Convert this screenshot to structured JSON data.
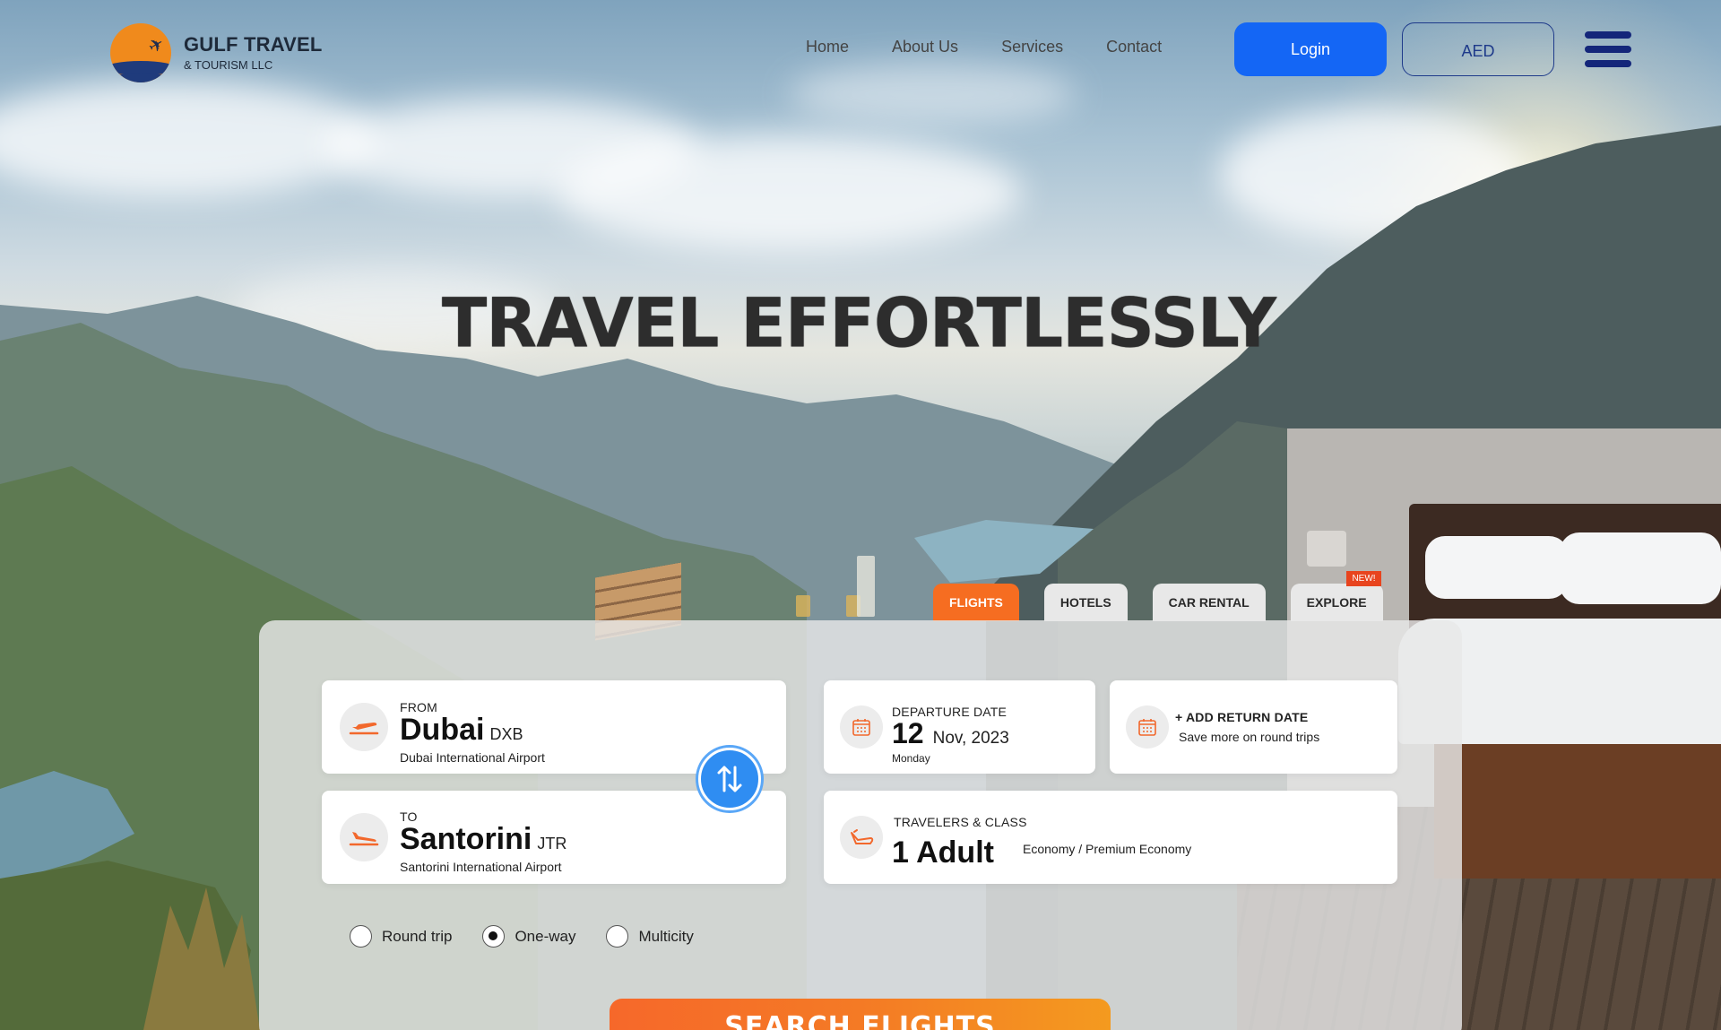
{
  "brand": {
    "title": "GULF TRAVEL",
    "subtitle": "& TOURISM LLC"
  },
  "nav": {
    "items": [
      "Home",
      "About Us",
      "Services",
      "Contact"
    ]
  },
  "header": {
    "login_label": "Login",
    "currency_label": "AED"
  },
  "hero": {
    "title": "TRAVEL EFFORTLESSLY"
  },
  "tabs": [
    {
      "label": "FLIGHTS",
      "active": true
    },
    {
      "label": "HOTELS",
      "active": false
    },
    {
      "label": "CAR RENTAL",
      "active": false
    },
    {
      "label": "EXPLORE",
      "active": false,
      "badge": "NEW!"
    }
  ],
  "search": {
    "from": {
      "label": "FROM",
      "city": "Dubai",
      "code": "DXB",
      "airport": "Dubai International Airport"
    },
    "to": {
      "label": "TO",
      "city": "Santorini",
      "code": "JTR",
      "airport": "Santorini International Airport"
    },
    "departure": {
      "label": "DEPARTURE DATE",
      "day": "12",
      "month_year": "Nov, 2023",
      "weekday": "Monday"
    },
    "return": {
      "label": "+ ADD RETURN DATE",
      "hint": "Save more on round trips"
    },
    "travelers": {
      "label": "TRAVELERS & CLASS",
      "count": "1",
      "type": "Adult",
      "class": "Economy / Premium Economy"
    },
    "trip_types": [
      {
        "label": "Round trip",
        "selected": false
      },
      {
        "label": "One-way",
        "selected": true
      },
      {
        "label": "Multicity",
        "selected": false
      }
    ],
    "submit_label": "SEARCH FLIGHTS"
  },
  "colors": {
    "accent_orange": "#f66d21",
    "primary_blue": "#1466f5",
    "navy": "#1e3a8a"
  },
  "icons": [
    "plane-logo-icon",
    "takeoff-icon",
    "landing-icon",
    "calendar-icon",
    "seat-icon",
    "swap-icon",
    "menu-icon"
  ]
}
